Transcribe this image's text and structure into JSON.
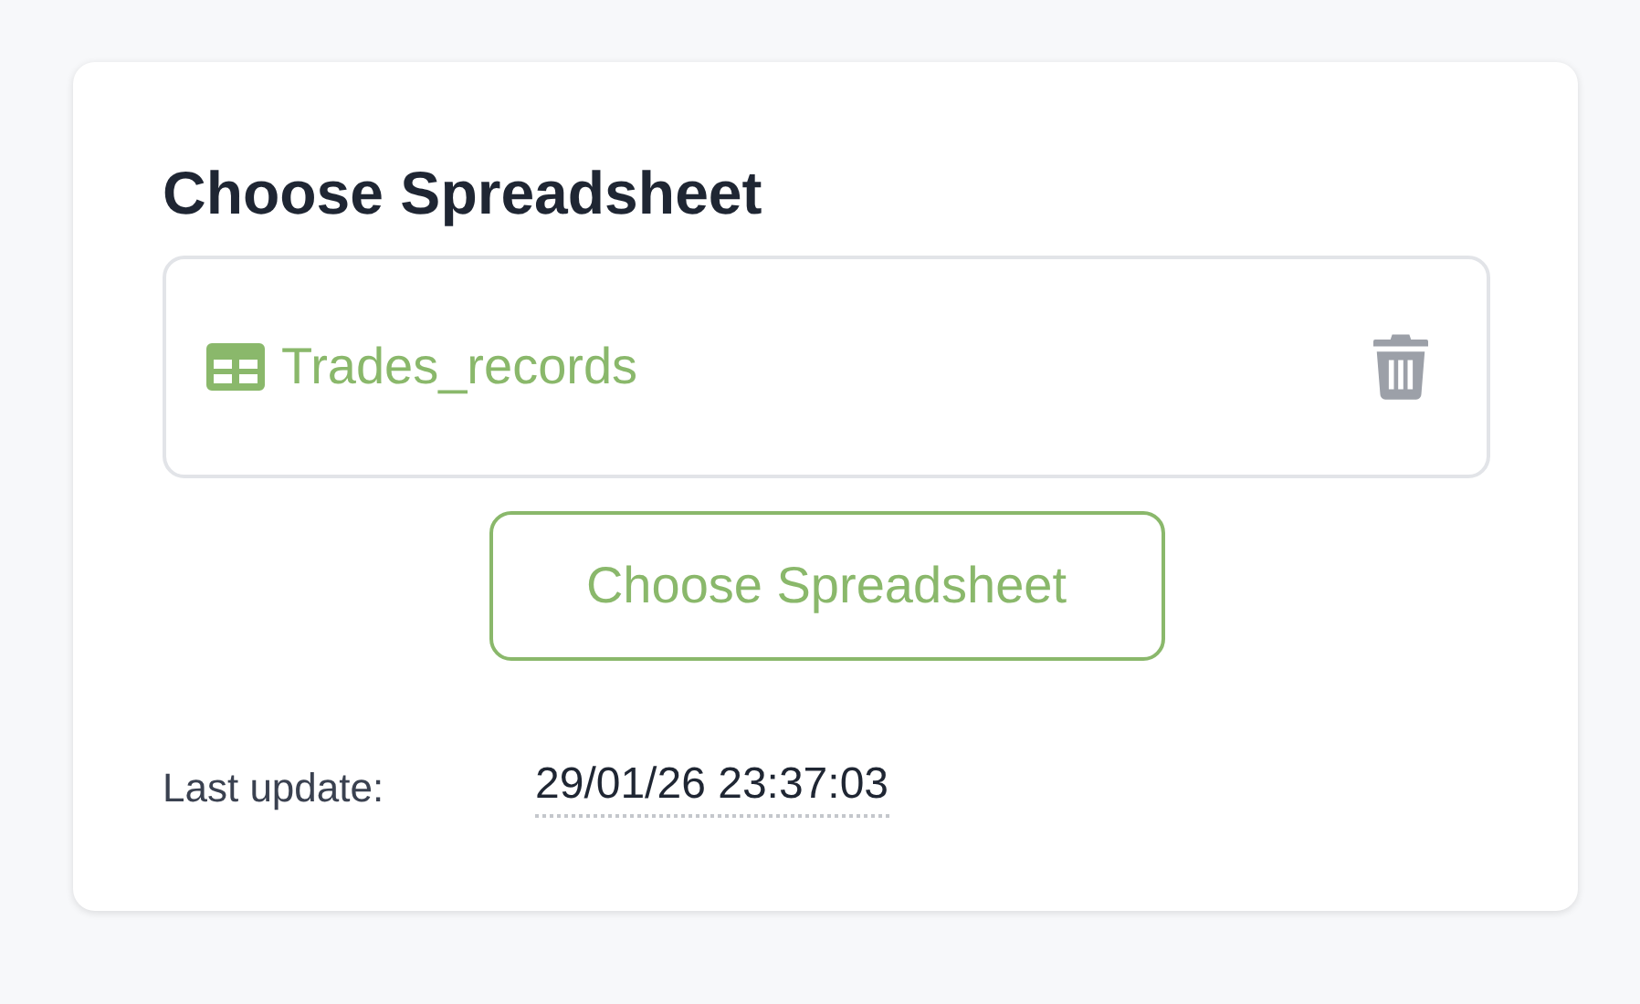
{
  "card": {
    "title": "Choose Spreadsheet",
    "file": {
      "name": "Trades_records"
    },
    "button": "Choose Spreadsheet",
    "last_update": {
      "label": "Last update:",
      "value": "29/01/26 23:37:03"
    }
  }
}
